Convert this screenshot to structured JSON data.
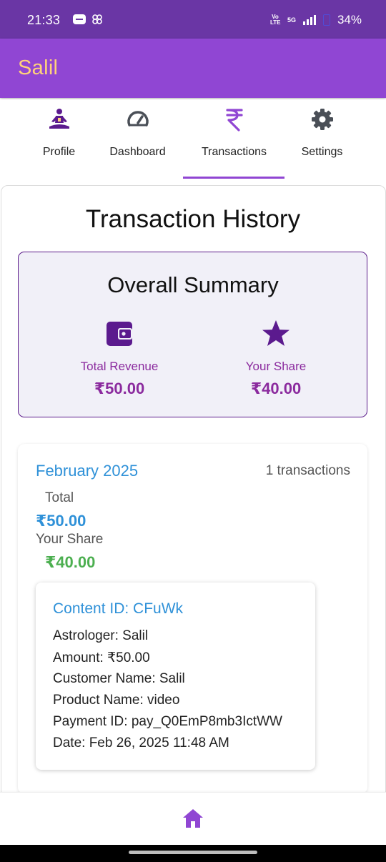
{
  "status_bar": {
    "time": "21:33",
    "volte": "Vo LTE",
    "network": "5G",
    "battery": "34%"
  },
  "app_bar": {
    "title": "Salil"
  },
  "tabs": [
    {
      "label": "Profile",
      "icon": "meditation-icon"
    },
    {
      "label": "Dashboard",
      "icon": "speedometer-icon"
    },
    {
      "label": "Transactions",
      "icon": "rupee-icon",
      "active": true
    },
    {
      "label": "Settings",
      "icon": "gear-icon"
    }
  ],
  "page": {
    "title": "Transaction History"
  },
  "summary": {
    "title": "Overall Summary",
    "revenue_label": "Total Revenue",
    "revenue_value": "₹50.00",
    "share_label": "Your Share",
    "share_value": "₹40.00"
  },
  "month": {
    "name": "February 2025",
    "count": "1 transactions",
    "total_label": "Total",
    "total_value": "₹50.00",
    "share_label": "Your Share",
    "share_value": "₹40.00"
  },
  "transaction": {
    "title": "Content ID: CFuWk",
    "astrologer": "Astrologer: Salil",
    "amount": "Amount: ₹50.00",
    "customer": "Customer Name: Salil",
    "product": "Product Name: video",
    "payment_id": "Payment ID: pay_Q0EmP8mb3IctWW",
    "date": "Date: Feb 26, 2025 11:48 AM"
  },
  "bottom_nav": {
    "icon": "home-icon"
  },
  "colors": {
    "status_bar": "#6a36a5",
    "app_bar": "#9046d3",
    "title_accent": "#ffd27a",
    "summary_text": "#8b2a9e",
    "blue": "#2f91d8",
    "green": "#4caf50",
    "icon_purple": "#5b1a8e"
  }
}
